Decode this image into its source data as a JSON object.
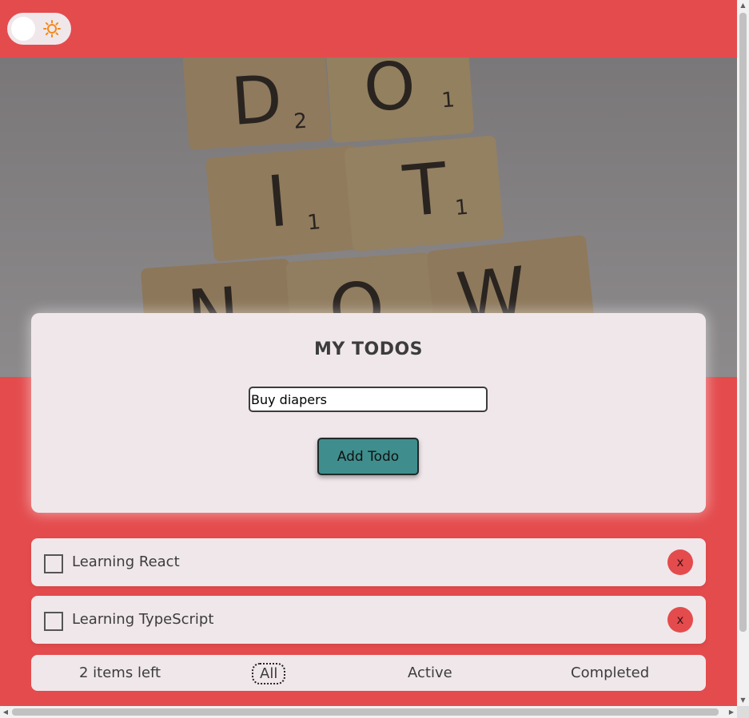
{
  "theme_toggle": {
    "icon": "sun-icon",
    "state": "light"
  },
  "hero": {
    "image": "scrabble tiles spelling DO IT NOW",
    "tiles": [
      "D",
      "O",
      "I",
      "T",
      "N",
      "O",
      "W"
    ]
  },
  "card": {
    "title": "MY TODOS",
    "input_value": "Buy diapers",
    "add_button_label": "Add Todo"
  },
  "todos": [
    {
      "label": "Learning React",
      "completed": false,
      "delete_label": "x"
    },
    {
      "label": "Learning TypeScript",
      "completed": false,
      "delete_label": "x"
    }
  ],
  "footer": {
    "items_left": "2 items left",
    "filters": {
      "all": "All",
      "active": "Active",
      "completed": "Completed"
    },
    "selected_filter": "All"
  },
  "colors": {
    "background": "#e44b4d",
    "card": "#f0e7ea",
    "button": "#3f8e8d",
    "delete_button": "#e44b4d",
    "text": "#3c3c3c"
  }
}
